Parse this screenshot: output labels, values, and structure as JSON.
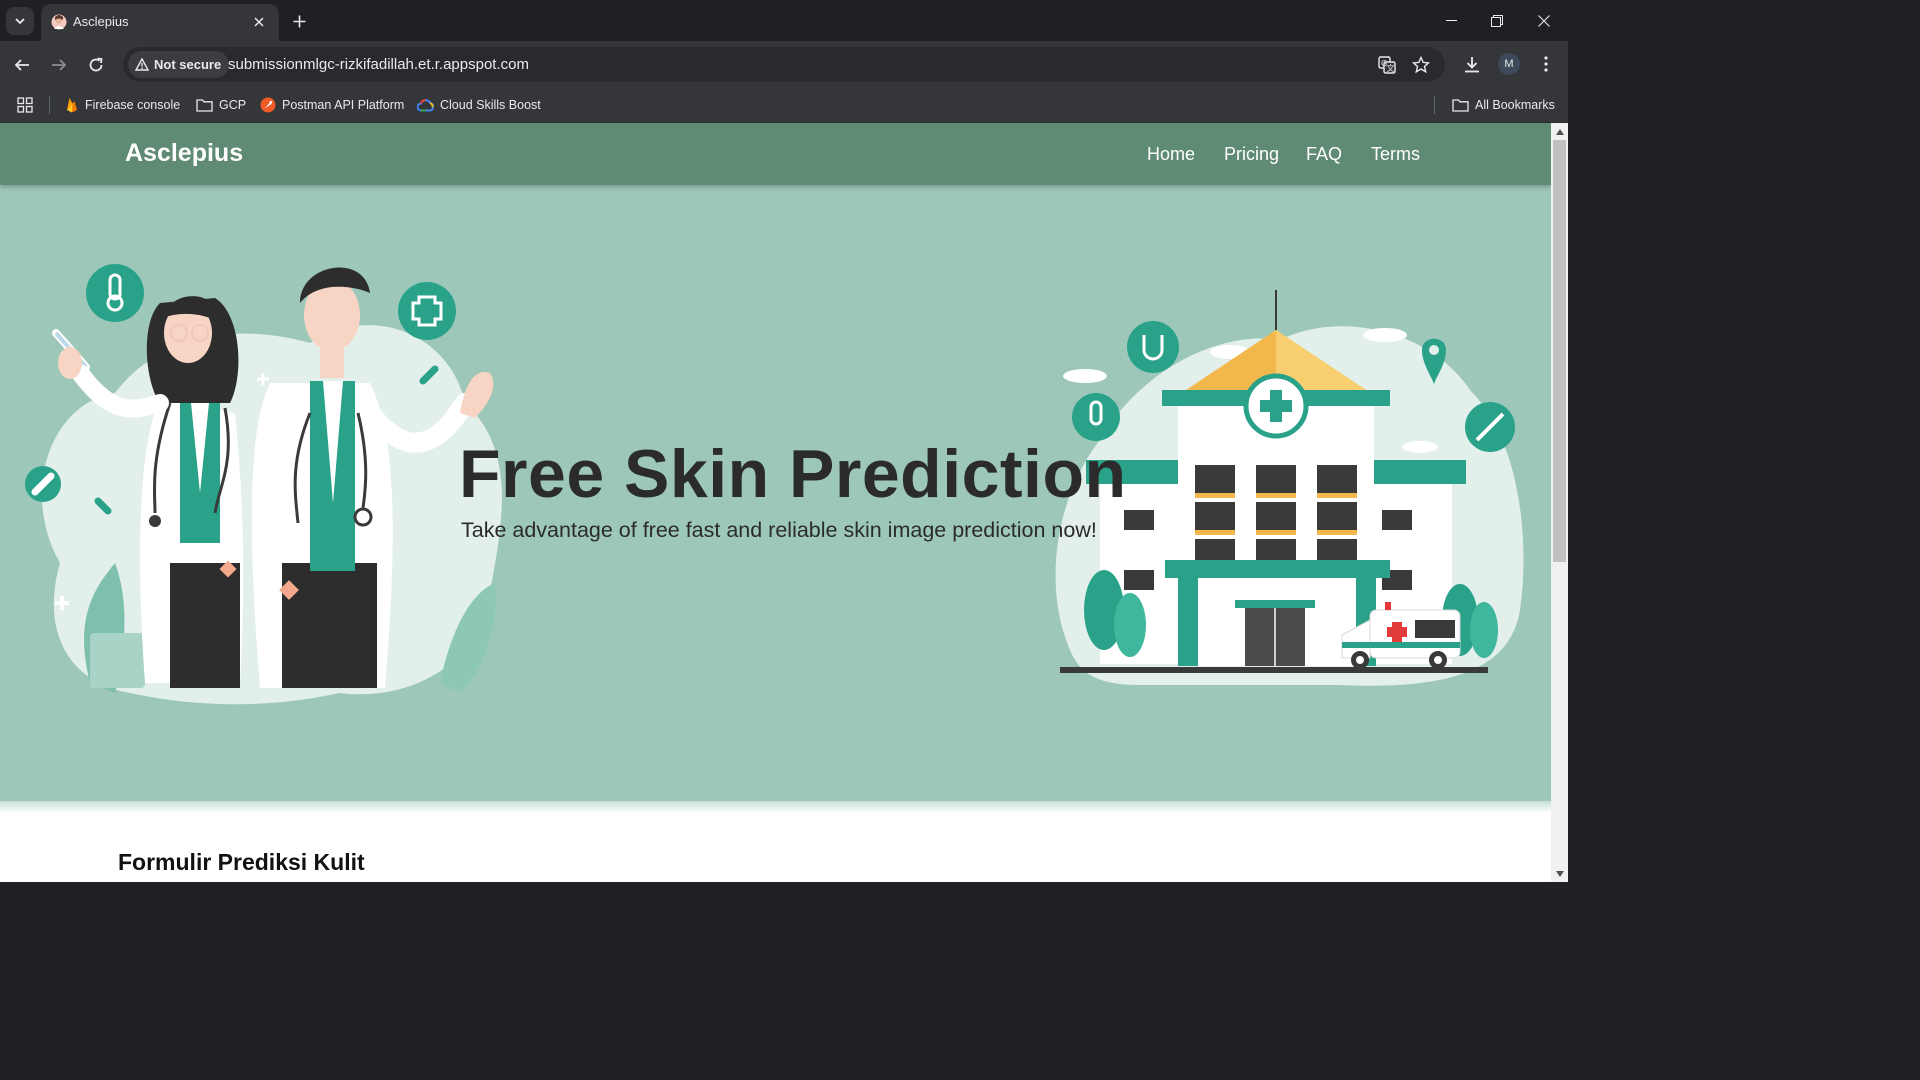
{
  "browser": {
    "tab_title": "Asclepius",
    "security_label": "Not secure",
    "url": "submissionmlgc-rizkifadillah.et.r.appspot.com",
    "profile_initial": "M",
    "bookmarks": [
      {
        "label": "Firebase console",
        "icon": "firebase-icon"
      },
      {
        "label": "GCP",
        "icon": "folder-icon"
      },
      {
        "label": "Postman API Platform",
        "icon": "postman-icon"
      },
      {
        "label": "Cloud Skills Boost",
        "icon": "google-cloud-icon"
      }
    ],
    "all_bookmarks_label": "All Bookmarks"
  },
  "site": {
    "brand": "Asclepius",
    "nav": [
      "Home",
      "Pricing",
      "FAQ",
      "Terms"
    ],
    "hero_title": "Free Skin Prediction",
    "hero_subtitle": "Take advantage of free fast and reliable skin image prediction now!",
    "form_title": "Formulir Prediksi Kulit"
  },
  "colors": {
    "nav_bg": "#5f8a73",
    "hero_bg": "#9dc8b9",
    "accent_teal": "#2aa28a",
    "chrome_dark": "#202124"
  }
}
